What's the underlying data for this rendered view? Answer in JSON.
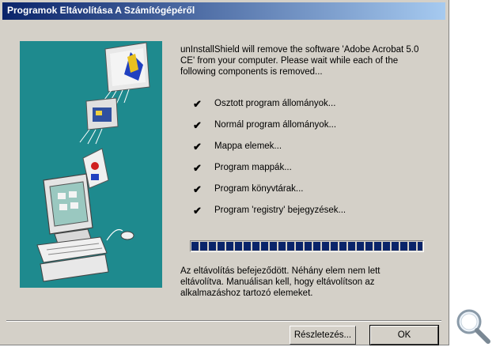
{
  "window": {
    "title": "Programok Eltávolítása A Számítógépéről"
  },
  "intro_text": "unInstallShield will remove the software 'Adobe Acrobat 5.0 CE' from your computer.  Please wait while each of the following components is removed...",
  "components": [
    {
      "label": "Osztott program állományok...",
      "checked": true
    },
    {
      "label": "Normál program állományok...",
      "checked": true
    },
    {
      "label": "Mappa elemek...",
      "checked": true
    },
    {
      "label": "Program mappák...",
      "checked": true
    },
    {
      "label": "Program könyvtárak...",
      "checked": true
    },
    {
      "label": "Program 'registry' bejegyzések...",
      "checked": true
    }
  ],
  "check_glyph": "✔",
  "progress": {
    "percent": 100
  },
  "status_text": "Az eltávolítás befejeződött. Néhány elem nem lett eltávolítva. Manuálisan kell, hogy eltávolítson az alkalmazáshoz tartozó elemeket.",
  "buttons": {
    "details_label": "Részletezés...",
    "ok_label": "OK"
  },
  "icons": {
    "illustration": "computer-install-illustration",
    "zoom": "magnifier-icon"
  },
  "colors": {
    "title_gradient_start": "#0a246a",
    "title_gradient_end": "#a6caf0",
    "panel_bg": "#1e8a8e",
    "progress_block": "#0a246a",
    "dialog_bg": "#d4d0c8"
  }
}
